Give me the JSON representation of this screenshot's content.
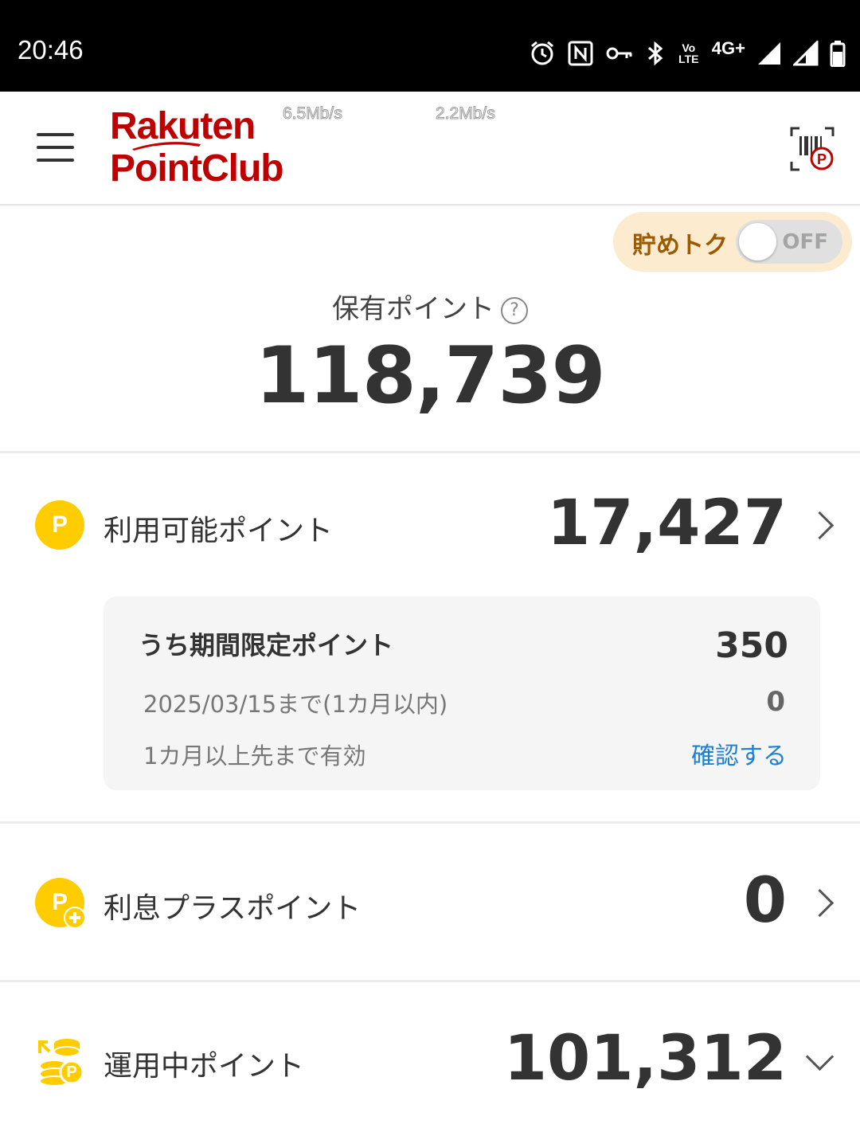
{
  "status_bar": {
    "time": "20:46",
    "network_label": "4G+",
    "volte_label": "Vo LTE",
    "icons": [
      "alarm-icon",
      "nfc-icon",
      "vpn-key-icon",
      "bluetooth-icon",
      "volte-icon",
      "signal-icon",
      "signal-icon",
      "battery-icon"
    ]
  },
  "app_bar": {
    "logo_line1": "Rakuten",
    "logo_line2": "PointClub",
    "speed_down": "6.5Mb/s",
    "speed_up": "2.2Mb/s",
    "brand_color": "#bf0000"
  },
  "savings_toggle": {
    "label": "貯めトク",
    "state": "OFF"
  },
  "held_points": {
    "label": "保有ポイント",
    "value": "118,739",
    "help_icon": "?"
  },
  "available_points": {
    "icon_letter": "P",
    "label": "利用可能ポイント",
    "value": "17,427",
    "limited": {
      "title": "うち期間限定ポイント",
      "total": "350",
      "expiring_label": "2025/03/15まで(1カ月以内)",
      "expiring_value": "0",
      "later_label": "1カ月以上先まで有効",
      "check_link": "確認する"
    }
  },
  "interest_points": {
    "icon_letter": "P",
    "label": "利息プラスポイント",
    "value": "0"
  },
  "invest_points": {
    "icon_letter": "P",
    "label": "運用中ポイント",
    "value": "101,312"
  },
  "colors": {
    "accent_yellow": "#ffcc00",
    "link_blue": "#1d80d3",
    "toggle_bg": "#fdebd0",
    "toggle_label": "#9a5b00"
  }
}
